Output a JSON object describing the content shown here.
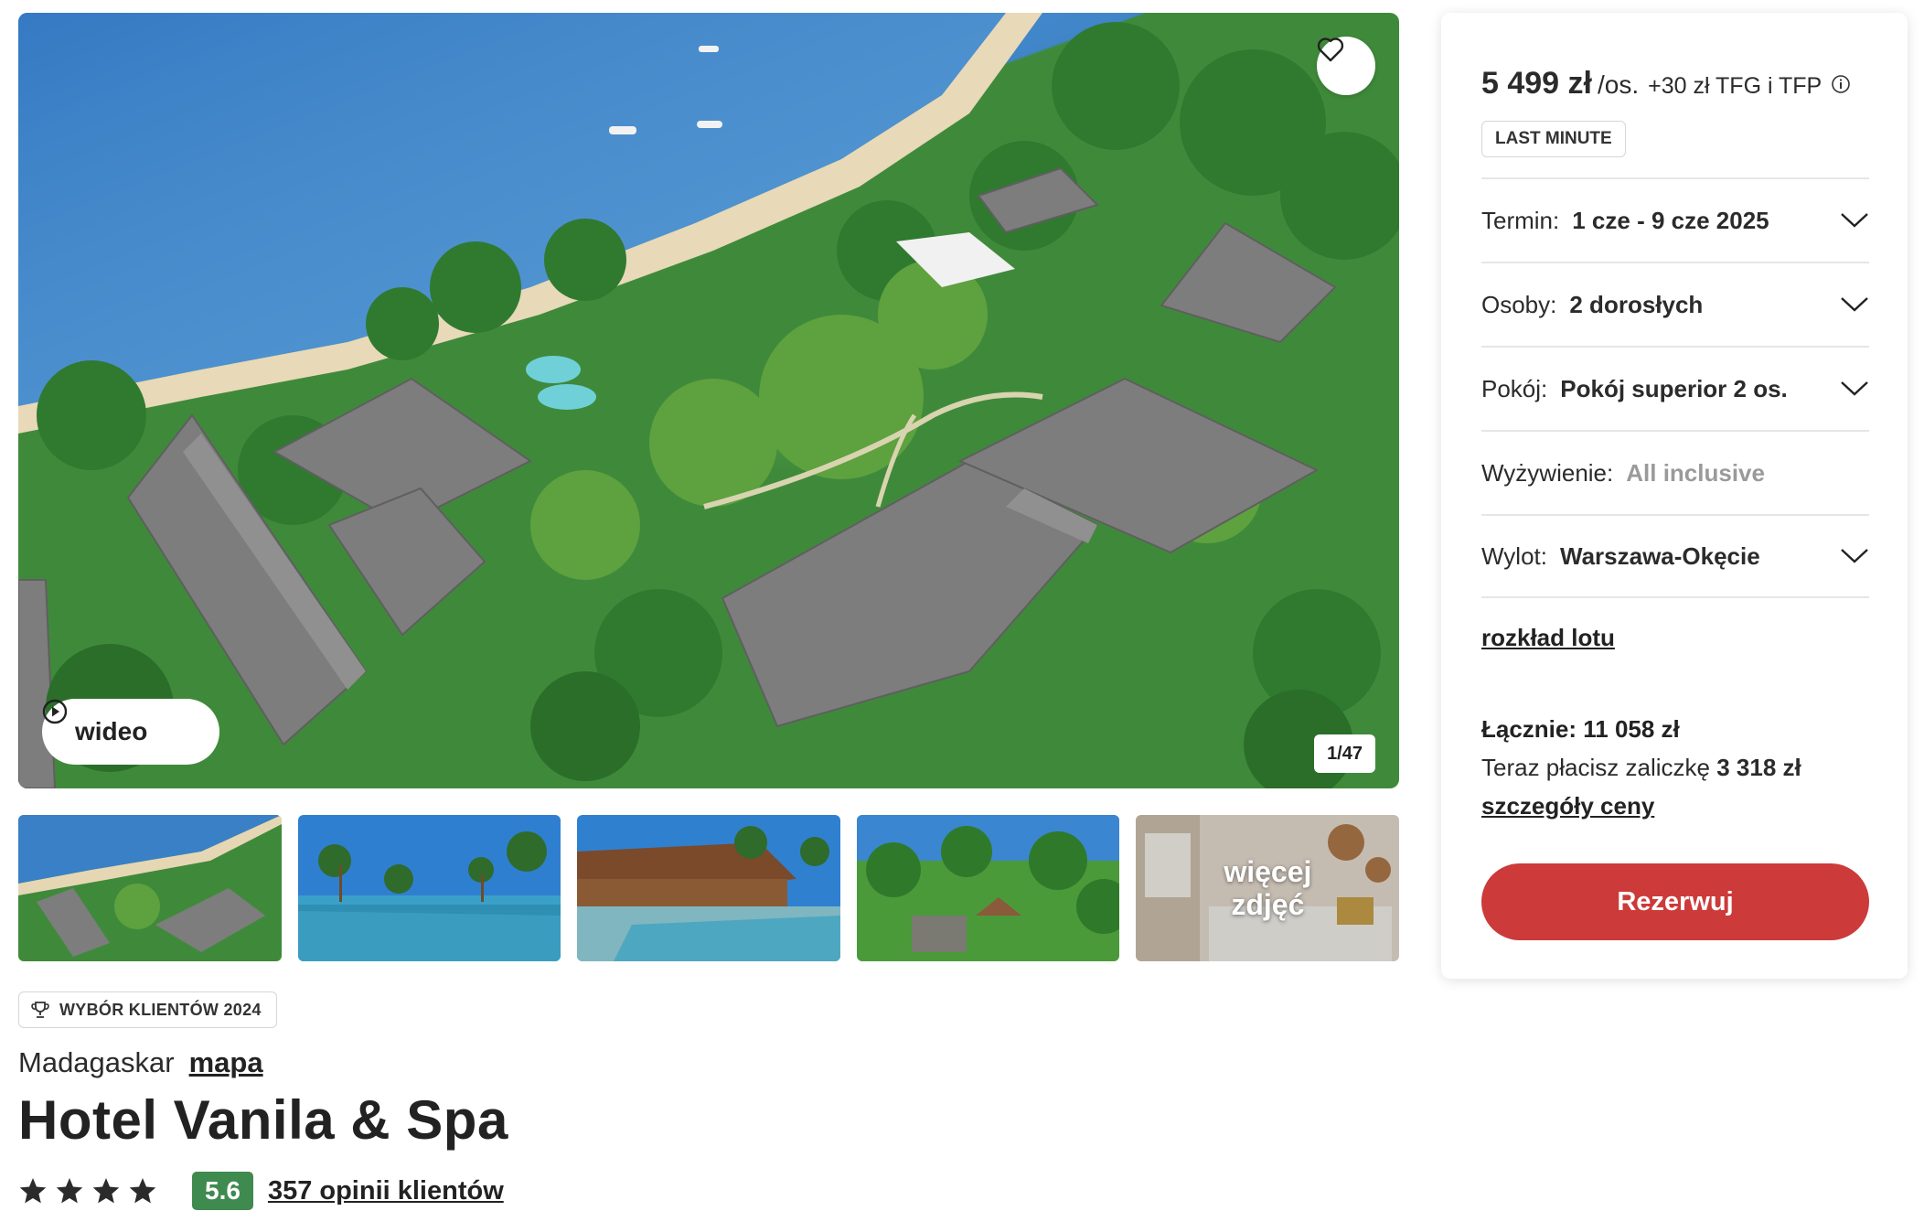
{
  "gallery": {
    "counter": "1/47",
    "video_label": "wideo",
    "more_photos_label": "więcej zdjęć"
  },
  "icons": {
    "heart": "heart-icon",
    "play": "play-circle-icon",
    "trophy": "trophy-icon",
    "star": "star-icon",
    "chevron": "chevron-down-icon",
    "info": "info-icon"
  },
  "hotel": {
    "badge": "WYBÓR KLIENTÓW 2024",
    "location": "Madagaskar",
    "map_link": "mapa",
    "name": "Hotel Vanila & Spa",
    "stars": 4,
    "score": "5.6",
    "reviews": "357 opinii klientów"
  },
  "booking": {
    "price": "5 499 zł",
    "price_unit": "/os.",
    "price_extra": "+30 zł TFG i TFP",
    "tag": "LAST MINUTE",
    "options": [
      {
        "label": "Termin:",
        "value": "1 cze - 9 cze 2025",
        "disabled": false
      },
      {
        "label": "Osoby:",
        "value": "2 dorosłych",
        "disabled": false
      },
      {
        "label": "Pokój:",
        "value": "Pokój superior 2 os.",
        "disabled": false
      },
      {
        "label": "Wyżywienie:",
        "value": "All inclusive",
        "disabled": true
      },
      {
        "label": "Wylot:",
        "value": "Warszawa-Okęcie",
        "disabled": false
      }
    ],
    "flight_link": "rozkład lotu",
    "total": "Łącznie: 11 058 zł",
    "deposit_prefix": "Teraz płacisz zaliczkę",
    "deposit_amount": "3 318 zł",
    "price_details_link": "szczegóły ceny",
    "book_button": "Rezerwuj"
  },
  "colors": {
    "accent_red": "#cc3a3a",
    "score_green": "#3f8a4f"
  }
}
